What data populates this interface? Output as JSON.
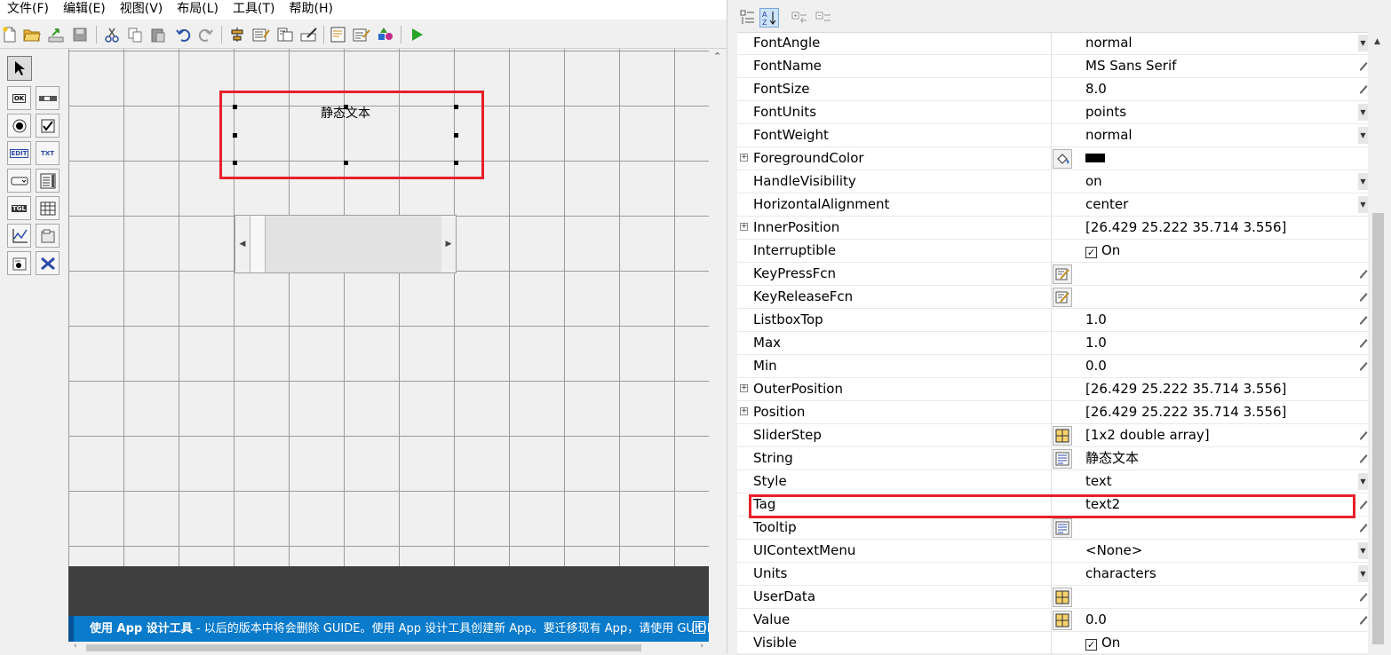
{
  "menu": [
    "文件(F)",
    "编辑(E)",
    "视图(V)",
    "布局(L)",
    "工具(T)",
    "帮助(H)"
  ],
  "toolbar": {
    "icons": [
      "new-file-icon",
      "open-folder-icon",
      "export-icon",
      "save-icon",
      "cut-icon",
      "copy-icon",
      "paste-icon",
      "undo-icon",
      "redo-icon",
      "align-icon",
      "menu-editor-icon",
      "tab-order-icon",
      "toolbar-editor-icon",
      "editor-icon",
      "property-inspector-icon",
      "object-browser-icon",
      "run-icon"
    ]
  },
  "palette": {
    "items": [
      "select-tool",
      "pushbutton-tool",
      "slider-tool",
      "radiobutton-tool",
      "checkbox-tool",
      "edit-text-tool",
      "static-text-tool",
      "popup-menu-tool",
      "listbox-tool",
      "toggle-button-tool",
      "table-tool",
      "axes-tool",
      "panel-tool",
      "button-group-tool",
      "activex-tool"
    ],
    "labels": {
      "ok": "OK",
      "edit": "EDIT",
      "txt": "TXT",
      "tgl": "TGL"
    }
  },
  "canvas": {
    "static_text": "静态文本"
  },
  "banner": {
    "bold_text": "使用 App 设计工具",
    "text": " - 以后的版本中将会删除 GUIDE。使用 App 设计工具创建新 App。要迁移现有 App，请使用 GUIDE to Ap...",
    "expand": "+"
  },
  "properties": [
    {
      "name": "FontAngle",
      "value": "normal",
      "control": "dropdown"
    },
    {
      "name": "FontName",
      "value": "MS Sans Serif",
      "control": "pencil"
    },
    {
      "name": "FontSize",
      "value": "8.0",
      "control": "pencil"
    },
    {
      "name": "FontUnits",
      "value": "points",
      "control": "dropdown"
    },
    {
      "name": "FontWeight",
      "value": "normal",
      "control": "dropdown"
    },
    {
      "name": "ForegroundColor",
      "value": "",
      "expand": true,
      "button": "paint-bucket-icon",
      "swatch": "#000000"
    },
    {
      "name": "HandleVisibility",
      "value": "on",
      "control": "dropdown"
    },
    {
      "name": "HorizontalAlignment",
      "value": "center",
      "control": "dropdown"
    },
    {
      "name": "InnerPosition",
      "value": "[26.429 25.222 35.714 3.556]",
      "expand": true
    },
    {
      "name": "Interruptible",
      "value": "On",
      "checkbox": true
    },
    {
      "name": "KeyPressFcn",
      "value": "",
      "button": "callback-pencil-icon",
      "control": "pencil"
    },
    {
      "name": "KeyReleaseFcn",
      "value": "",
      "button": "callback-pencil-icon",
      "control": "pencil"
    },
    {
      "name": "ListboxTop",
      "value": "1.0",
      "control": "pencil"
    },
    {
      "name": "Max",
      "value": "1.0",
      "control": "pencil"
    },
    {
      "name": "Min",
      "value": "0.0",
      "control": "pencil"
    },
    {
      "name": "OuterPosition",
      "value": "[26.429 25.222 35.714 3.556]",
      "expand": true
    },
    {
      "name": "Position",
      "value": "[26.429 25.222 35.714 3.556]",
      "expand": true
    },
    {
      "name": "SliderStep",
      "value": "[1x2  double array]",
      "button": "array-grid-icon",
      "control": "pencil"
    },
    {
      "name": "String",
      "value": "静态文本",
      "button": "text-lines-icon",
      "control": "pencil"
    },
    {
      "name": "Style",
      "value": "text",
      "control": "dropdown"
    },
    {
      "name": "Tag",
      "value": "text2",
      "control": "pencil",
      "highlight": true
    },
    {
      "name": "Tooltip",
      "value": "",
      "button": "text-lines-icon",
      "control": "pencil"
    },
    {
      "name": "UIContextMenu",
      "value": "<None>",
      "control": "dropdown"
    },
    {
      "name": "Units",
      "value": "characters",
      "control": "dropdown"
    },
    {
      "name": "UserData",
      "value": "",
      "button": "array-grid-icon",
      "control": "pencil"
    },
    {
      "name": "Value",
      "value": "0.0",
      "button": "array-grid-icon",
      "control": "pencil"
    },
    {
      "name": "Visible",
      "value": "On",
      "checkbox": true
    }
  ],
  "colors": {
    "highlight": "#e8202a",
    "banner": "#0a7acb",
    "canvas_bottom": "#3f3f3f"
  }
}
